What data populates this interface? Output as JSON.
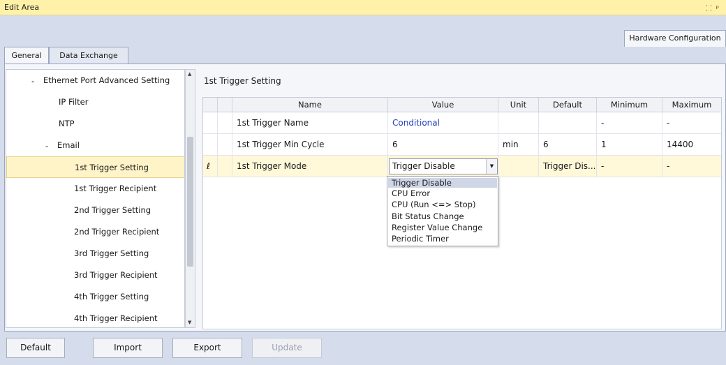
{
  "titlebar": {
    "title": "Edit Area",
    "icons": [
      "pin-icon",
      "dock-icon"
    ]
  },
  "hardware_tab": "Hardware Configuration",
  "tabs": [
    {
      "label": "General"
    },
    {
      "label": "Data Exchange"
    }
  ],
  "tree": {
    "items": [
      {
        "label": "Ethernet Port Advanced Setting",
        "dash": "-"
      },
      {
        "label": "IP Filter"
      },
      {
        "label": "NTP"
      },
      {
        "label": "Email",
        "dash": "-"
      },
      {
        "label": "1st Trigger Setting",
        "selected": true
      },
      {
        "label": "1st Trigger Recipient"
      },
      {
        "label": "2nd Trigger Setting"
      },
      {
        "label": "2nd Trigger Recipient"
      },
      {
        "label": "3rd Trigger Setting"
      },
      {
        "label": "3rd Trigger Recipient"
      },
      {
        "label": "4th Trigger Setting"
      },
      {
        "label": "4th Trigger Recipient"
      }
    ]
  },
  "settings": {
    "title": "1st Trigger Setting",
    "columns": [
      "Name",
      "Value",
      "Unit",
      "Default",
      "Minimum",
      "Maximum"
    ],
    "rows": [
      {
        "name": "1st Trigger Name",
        "value": "Conditional",
        "unit": "",
        "default": "",
        "min": "-",
        "max": "-"
      },
      {
        "name": "1st Trigger Min Cycle",
        "value": "6",
        "unit": "min",
        "default": "6",
        "min": "1",
        "max": "14400"
      },
      {
        "name": "1st Trigger Mode",
        "value": "Trigger Disable",
        "unit": "",
        "default": "Trigger Dis...",
        "min": "-",
        "max": "-"
      }
    ],
    "edit_marker": "ℓ"
  },
  "dropdown": {
    "options": [
      "Trigger Disable",
      "CPU Error",
      "CPU (Run <=> Stop)",
      "Bit Status Change",
      "Register Value Change",
      "Periodic Timer"
    ],
    "highlighted": "Trigger Disable"
  },
  "buttons": {
    "default": "Default",
    "import": "Import",
    "export": "Export",
    "update": "Update"
  }
}
